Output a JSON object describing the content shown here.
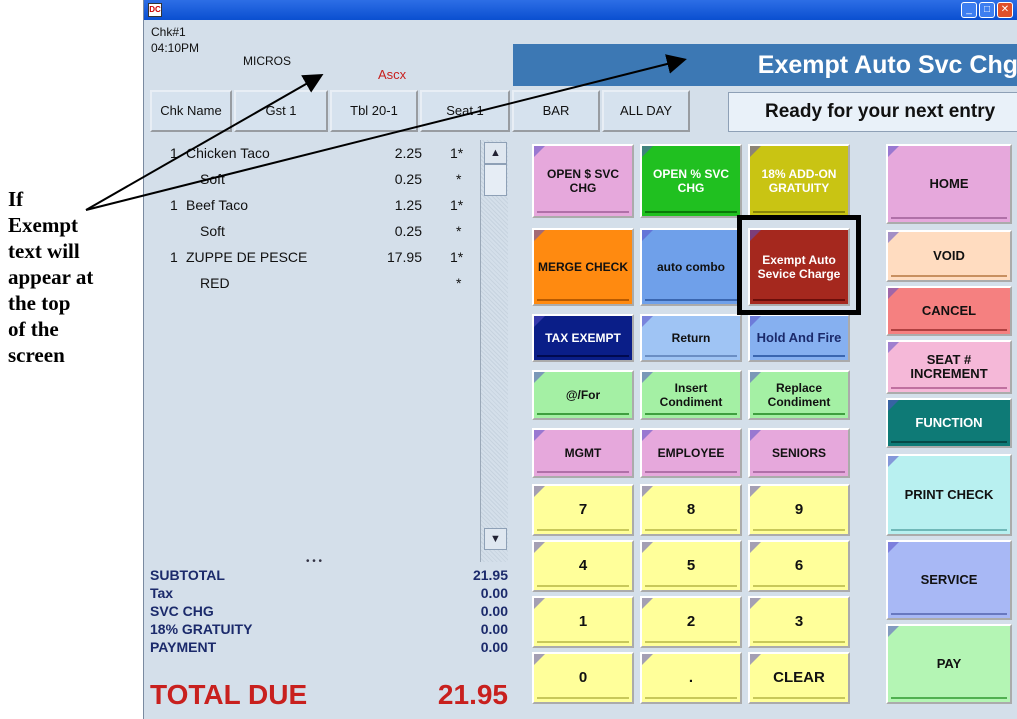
{
  "annotation": {
    "lines": [
      "If",
      "Exempt",
      "text will",
      "appear at",
      "the top",
      "of the",
      "screen"
    ]
  },
  "window": {
    "icon_label": "DC"
  },
  "header": {
    "chk_number": "Chk#1",
    "time": "04:10PM",
    "micros": "MICROS",
    "ascx": "Ascx",
    "title": "Exempt Auto Svc Chg",
    "status": "Ready for your next entry"
  },
  "top_buttons": [
    "Chk Name",
    "Gst 1",
    "Tbl  20-1",
    "Seat 1",
    "BAR",
    "ALL DAY"
  ],
  "items": [
    {
      "qty": "1",
      "name": "Chicken Taco",
      "price": "2.25",
      "seat": "1*"
    },
    {
      "qty": "",
      "name": "Soft",
      "price": "0.25",
      "seat": "*"
    },
    {
      "qty": "1",
      "name": "Beef Taco",
      "price": "1.25",
      "seat": "1*"
    },
    {
      "qty": "",
      "name": "Soft",
      "price": "0.25",
      "seat": "*"
    },
    {
      "qty": "1",
      "name": "ZUPPE DE PESCE",
      "price": "17.95",
      "seat": "1*"
    },
    {
      "qty": "",
      "name": "RED",
      "price": "",
      "seat": "*"
    }
  ],
  "totals": {
    "rows": [
      {
        "label": "SUBTOTAL",
        "value": "21.95"
      },
      {
        "label": "Tax",
        "value": "0.00"
      },
      {
        "label": "SVC CHG",
        "value": "0.00"
      },
      {
        "label": "18% GRATUITY",
        "value": "0.00"
      },
      {
        "label": "PAYMENT",
        "value": "0.00"
      }
    ],
    "total_label": "TOTAL DUE",
    "total_value": "21.95"
  },
  "function_buttons": {
    "open_svc": "OPEN $ SVC CHG",
    "open_pct": "OPEN % SVC CHG",
    "addon_gratuity": "18% ADD-ON GRATUITY",
    "merge_check": "MERGE CHECK",
    "auto_combo": "auto combo",
    "exempt_auto": "Exempt Auto Sevice Charge",
    "tax_exempt": "TAX EXEMPT",
    "return": "Return",
    "hold_fire": "Hold And Fire",
    "at_for": "@/For",
    "insert_condiment": "Insert Condiment",
    "replace_condiment": "Replace Condiment",
    "mgmt": "MGMT",
    "employee": "EMPLOYEE",
    "seniors": "SENIORS"
  },
  "keypad": [
    "7",
    "8",
    "9",
    "4",
    "5",
    "6",
    "1",
    "2",
    "3",
    "0",
    ".",
    "CLEAR"
  ],
  "right_buttons": {
    "home": "HOME",
    "void": "VOID",
    "cancel": "CANCEL",
    "seat_increment": "SEAT # INCREMENT",
    "function": "FUNCTION",
    "print_check": "PRINT CHECK",
    "service": "SERVICE",
    "pay": "PAY"
  }
}
